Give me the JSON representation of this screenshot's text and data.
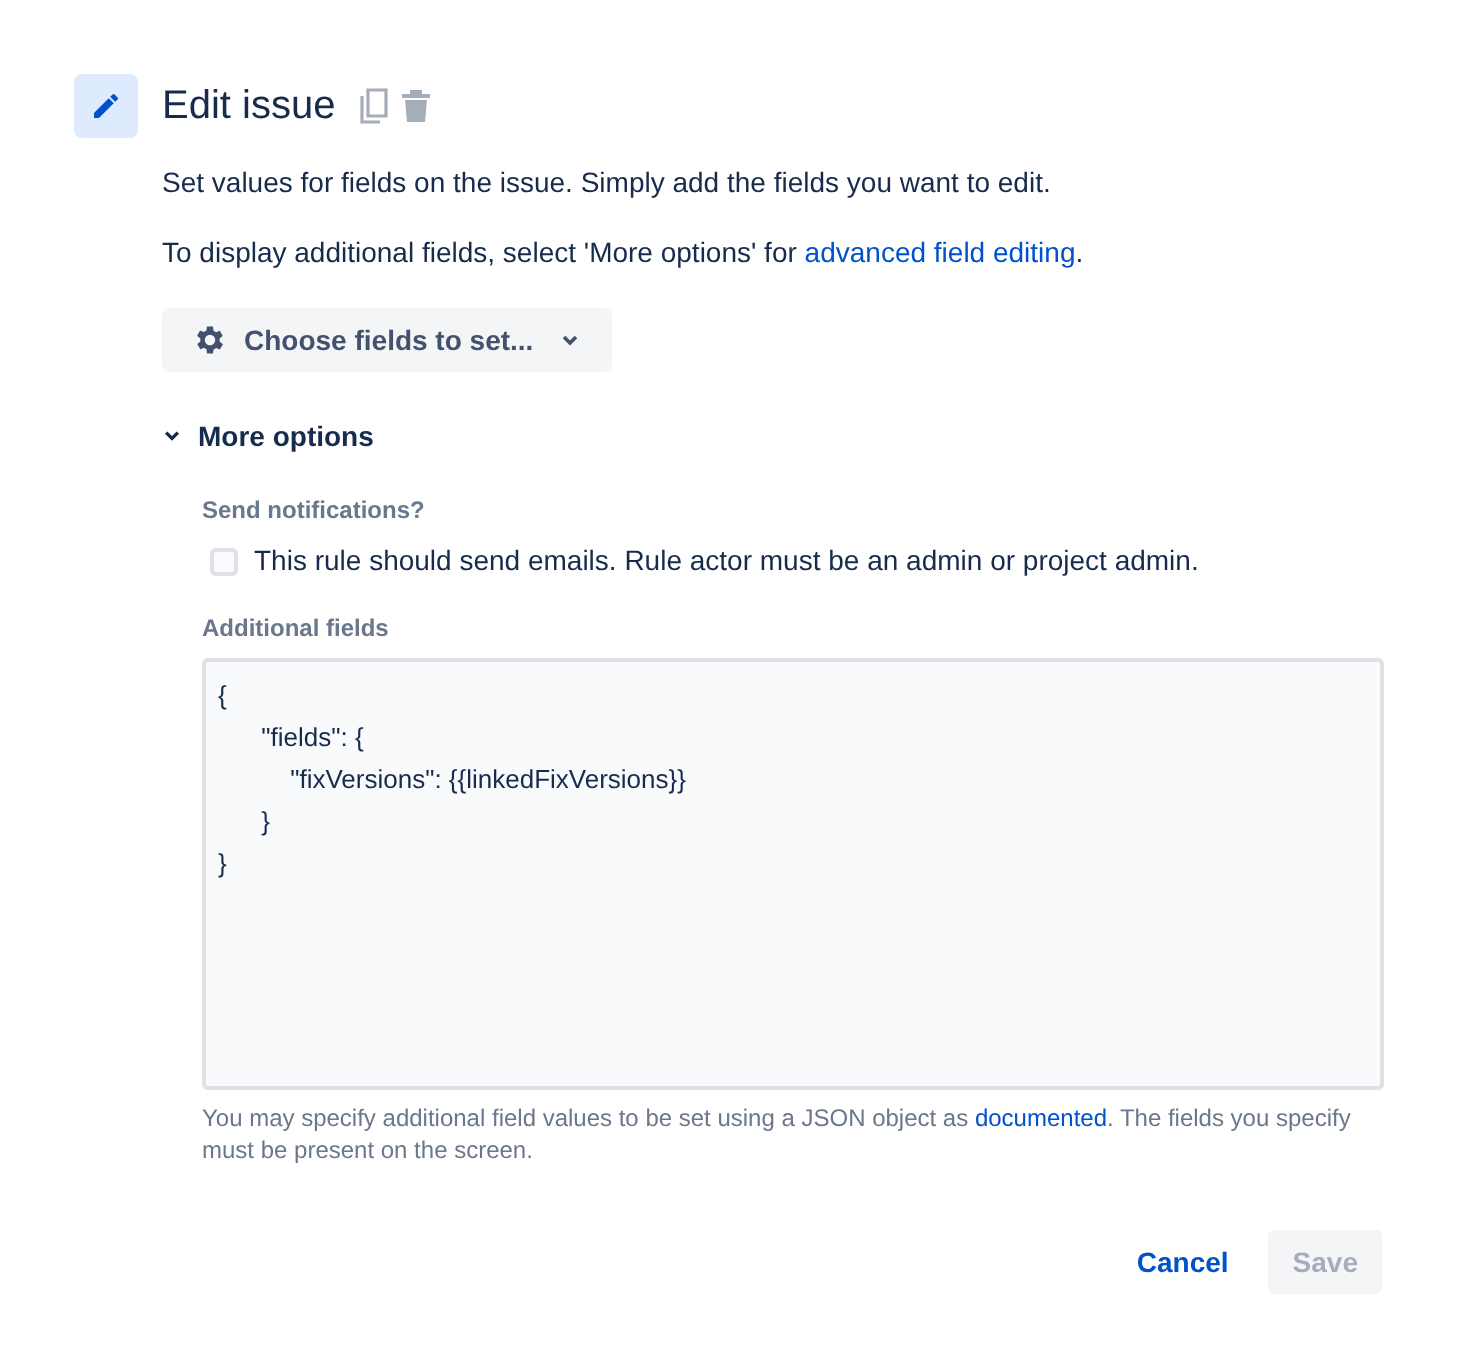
{
  "header": {
    "title": "Edit issue"
  },
  "description": "Set values for fields on the issue. Simply add the fields you want to edit.",
  "more_info": {
    "before": "To display additional fields, select 'More options' for ",
    "link": "advanced field editing",
    "after": "."
  },
  "choose_fields_button": {
    "label": "Choose fields to set..."
  },
  "more_options": {
    "label": "More options",
    "expanded": true
  },
  "notifications": {
    "label": "Send notifications?",
    "checkbox": {
      "label": "This rule should send emails. Rule actor must be an admin or project admin.",
      "checked": false
    }
  },
  "additional_fields": {
    "label": "Additional fields",
    "value": "{\n      \"fields\": {\n          \"fixVersions\": {{linkedFixVersions}}\n      }\n}",
    "help": {
      "before": "You may specify additional field values to be set using a JSON object as ",
      "link": "documented",
      "after": ". The fields you specify must be present on the screen."
    }
  },
  "buttons": [
    {
      "label": "Cancel",
      "kind": "link",
      "disabled": false
    },
    {
      "label": "Save",
      "kind": "primary",
      "disabled": true
    }
  ]
}
